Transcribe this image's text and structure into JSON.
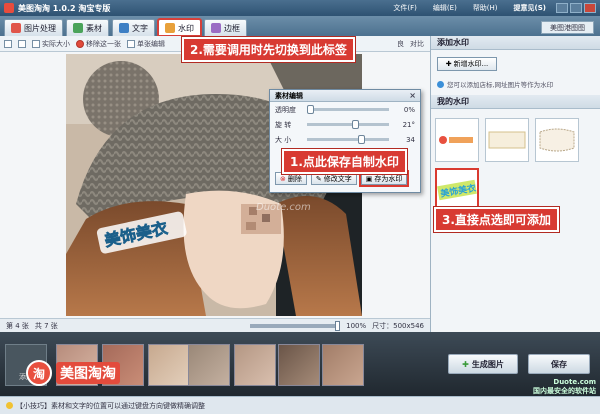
{
  "app": {
    "title": "美图淘淘 1.0.2 淘宝专版",
    "menu": [
      "文件(F)",
      "编辑(E)",
      "帮助(H)",
      "提意见(S)"
    ],
    "beauty_button": "美图港图图"
  },
  "tabs": [
    {
      "label": "图片处理",
      "icon": "image-edit-icon"
    },
    {
      "label": "素材",
      "icon": "material-icon"
    },
    {
      "label": "文字",
      "icon": "text-icon"
    },
    {
      "label": "水印",
      "icon": "watermark-icon",
      "active": true
    },
    {
      "label": "边框",
      "icon": "border-icon"
    }
  ],
  "toolbar": {
    "actual_size": "实际大小",
    "remove_one": "移除这一张",
    "single_edit": "单张编辑",
    "right_labels": [
      "良",
      "对比"
    ]
  },
  "dialog": {
    "title": "素材编辑",
    "rows": [
      {
        "label": "透明度",
        "value": "0%",
        "level": 0.0
      },
      {
        "label": "旋 转",
        "value": "21°",
        "level": 0.55
      },
      {
        "label": "大 小",
        "value": "34",
        "level": 0.62
      }
    ],
    "buttons": {
      "delete": "删除",
      "edit_text": "修改文字",
      "save_watermark": "存为水印"
    }
  },
  "right_panel": {
    "add_title": "添加水印",
    "new_watermark_btn": "新增水印...",
    "tip": "您可以添加店标,网址图片等作为水印",
    "my_title": "我的水印"
  },
  "status": {
    "page": "第 4 张",
    "total": "共 7 张",
    "zoom": "100%",
    "size": "尺寸：500x546"
  },
  "callouts": {
    "c1": "1.点此保存自制水印",
    "c2": "2.需要调用时先切换到此标签",
    "c3": "3.直接点选即可添加"
  },
  "watermark_text": "美饰美衣",
  "site_watermark": "Duote.com",
  "bottom": {
    "add_label": "添加",
    "logo_text": "美图淘淘",
    "logo_char": "淘",
    "generate_btn": "生成图片",
    "save_btn": "保存"
  },
  "tipbar": "【小技巧】素材和文字的位置可以通过键盘方向键做精确调整",
  "corner_watermark": {
    "line1": "Duote.com",
    "line2": "国内最安全的软件站"
  }
}
